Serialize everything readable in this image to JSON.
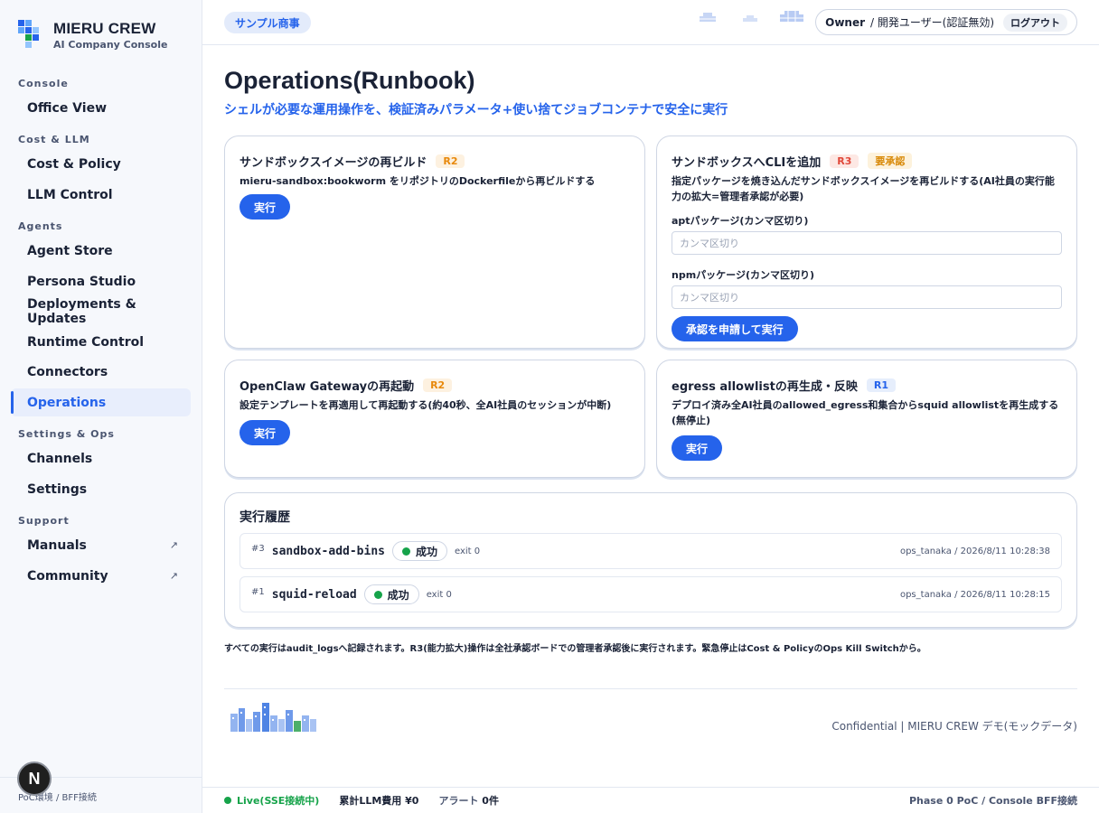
{
  "brand": {
    "title": "MIERU CREW",
    "subtitle": "AI Company Console"
  },
  "sidebar": {
    "sections": [
      {
        "label": "Console"
      },
      {
        "label": "Cost & LLM"
      },
      {
        "label": "Agents"
      },
      {
        "label": "Settings & Ops"
      },
      {
        "label": "Support"
      }
    ],
    "items": [
      {
        "label": "Office View"
      },
      {
        "label": "Cost & Policy"
      },
      {
        "label": "LLM Control"
      },
      {
        "label": "Agent Store"
      },
      {
        "label": "Persona Studio"
      },
      {
        "label": "Deployments & Updates"
      },
      {
        "label": "Runtime Control"
      },
      {
        "label": "Connectors"
      },
      {
        "label": "Operations"
      },
      {
        "label": "Channels"
      },
      {
        "label": "Settings"
      },
      {
        "label": "Manuals",
        "external": "↗"
      },
      {
        "label": "Community",
        "external": "↗"
      }
    ],
    "active": "Operations",
    "footer": "PoC環境 / BFF接続",
    "badge": "N"
  },
  "topbar": {
    "company": "サンプル商事",
    "user_role": "Owner",
    "user_name": "/ 開発ユーザー(認証無効)",
    "logout": "ログアウト"
  },
  "page": {
    "title": "Operations(Runbook)",
    "subtitle": "シェルが必要な運用操作を、検証済みパラメータ+使い捨てジョブコンテナで安全に実行"
  },
  "cards": [
    {
      "title": "サンドボックスイメージの再ビルド",
      "risk": "R2",
      "desc": "mieru-sandbox:bookworm をリポジトリのDockerfileから再ビルドする",
      "button": "実行"
    },
    {
      "title": "サンドボックスへCLIを追加",
      "risk": "R3",
      "approval": "要承認",
      "desc": "指定パッケージを焼き込んだサンドボックスイメージを再ビルドする(AI社員の実行能力の拡大=管理者承認が必要)",
      "fields": [
        {
          "label": "aptパッケージ(カンマ区切り)",
          "placeholder": "カンマ区切り",
          "value": ""
        },
        {
          "label": "npmパッケージ(カンマ区切り)",
          "placeholder": "カンマ区切り",
          "value": ""
        }
      ],
      "button": "承認を申請して実行"
    },
    {
      "title": "OpenClaw Gatewayの再起動",
      "risk": "R2",
      "desc": "設定テンプレートを再適用して再起動する(約40秒、全AI社員のセッションが中断)",
      "button": "実行"
    },
    {
      "title": "egress allowlistの再生成・反映",
      "risk": "R1",
      "desc": "デプロイ済み全AI社員のallowed_egress和集合からsquid allowlistを再生成する(無停止)",
      "button": "実行"
    }
  ],
  "history": {
    "title": "実行履歴",
    "rows": [
      {
        "num": "#3",
        "name": "sandbox-add-bins",
        "status": "成功",
        "exit": "exit 0",
        "meta": "ops_tanaka / 2026/8/11 10:28:38"
      },
      {
        "num": "#1",
        "name": "squid-reload",
        "status": "成功",
        "exit": "exit 0",
        "meta": "ops_tanaka / 2026/8/11 10:28:15"
      }
    ]
  },
  "audit_note": "すべての実行はaudit_logsへ記録されます。R3(能力拡大)操作は全社承認ボードでの管理者承認後に実行されます。緊急停止はCost & PolicyのOps Kill Switchから。",
  "footer": {
    "right": "Confidential | MIERU CREW デモ(モックデータ)"
  },
  "statusbar": {
    "live": "Live(SSE接続中)",
    "cost": "累計LLM費用 ¥0",
    "alerts_label": "アラート",
    "alerts_count": "0件",
    "right": "Phase 0 PoC / Console BFF接続"
  },
  "colors": {
    "accent": "#2563eb",
    "success": "#16a34a",
    "r2": "#e8890c",
    "r3": "#e0483a"
  }
}
